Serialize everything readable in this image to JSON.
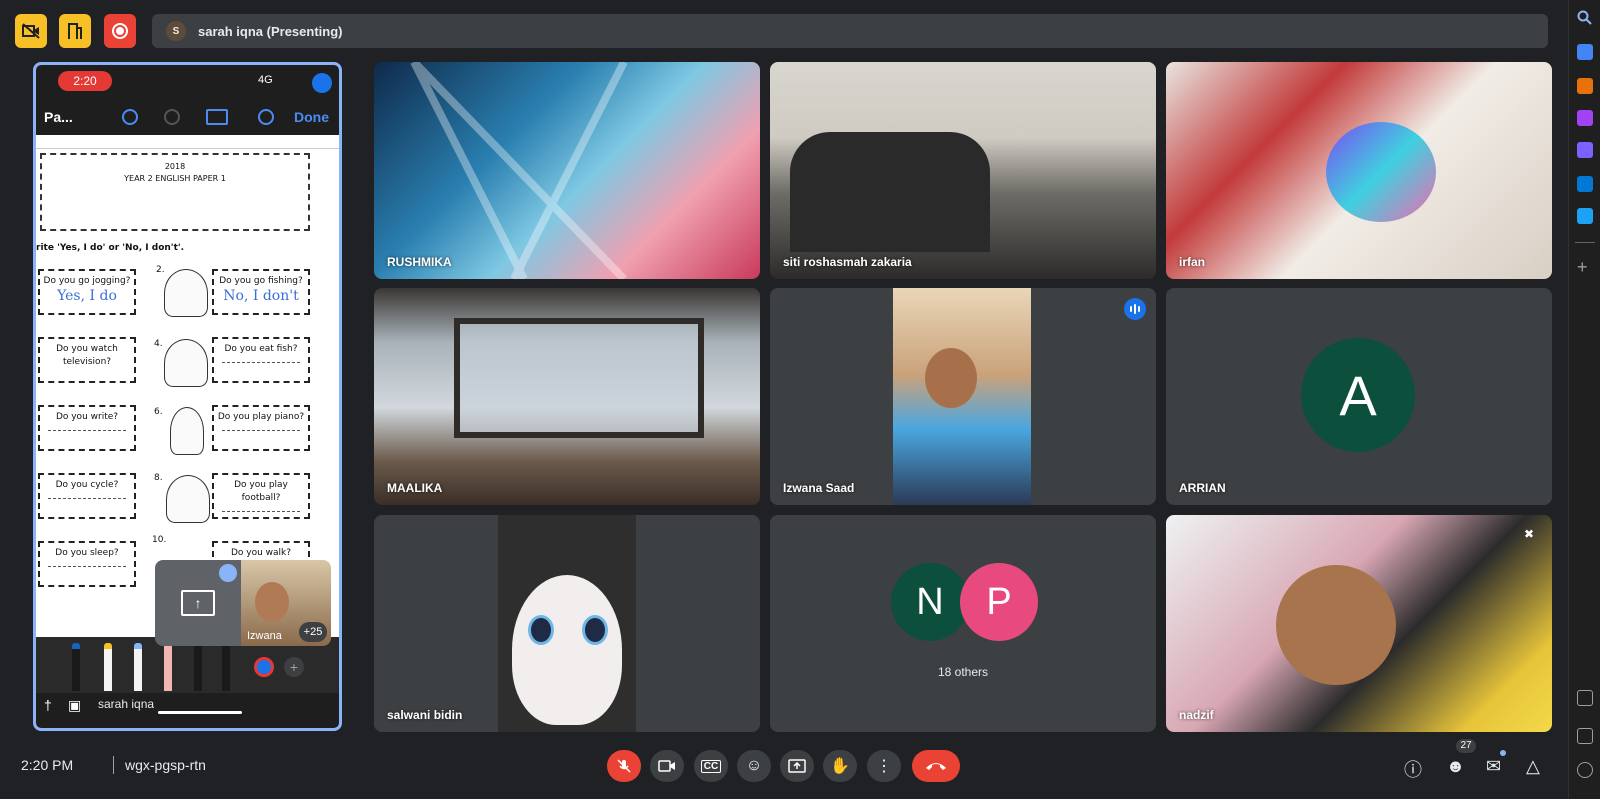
{
  "top_bar": {
    "presenter_initial": "S",
    "presenter_text": "sarah iqna (Presenting)"
  },
  "presentation": {
    "phone_time": "2:20",
    "network": "4G",
    "doc_title": "Pa...",
    "done_label": "Done",
    "paper": {
      "year": "2018",
      "heading": "YEAR 2 ENGLISH PAPER 1",
      "instruction": "rite 'Yes, I do' or 'No, I don't'.",
      "questions": [
        {
          "text": "Do you go jogging?",
          "answer": "Yes, I do"
        },
        {
          "num": "2.",
          "text": "Do you go fishing?",
          "answer": "No, I don't"
        },
        {
          "text": "Do you watch television?"
        },
        {
          "num": "4.",
          "text": "Do you eat fish?"
        },
        {
          "text": "Do you write?"
        },
        {
          "num": "6.",
          "text": "Do you play piano?"
        },
        {
          "text": "Do you cycle?"
        },
        {
          "num": "8.",
          "text": "Do you play football?"
        },
        {
          "text": "Do you sleep?"
        },
        {
          "num": "10.",
          "text": "Do you walk?"
        }
      ]
    },
    "presenter_name": "sarah iqna",
    "pip": {
      "name": "Izwana",
      "more": "+25"
    }
  },
  "tiles": [
    {
      "name": "RUSHMIKA"
    },
    {
      "name": "siti roshasmah zakaria"
    },
    {
      "name": "irfan"
    },
    {
      "name": "MAALIKA"
    },
    {
      "name": "Izwana Saad"
    },
    {
      "name": "ARRIAN",
      "initial": "A"
    },
    {
      "name": "salwani bidin"
    },
    {
      "initials": [
        "N",
        "P"
      ],
      "others": "18 others"
    },
    {
      "name": "nadzif"
    }
  ],
  "bottom_bar": {
    "time": "2:20 PM",
    "meeting_code": "wgx-pgsp-rtn",
    "participant_count": "27"
  },
  "colors": {
    "present_border": "#8ab4f8",
    "danger": "#ea4335",
    "accent": "#1a73e8",
    "avatar_green": "#0b4f3c",
    "avatar_pink": "#e84a7f"
  }
}
